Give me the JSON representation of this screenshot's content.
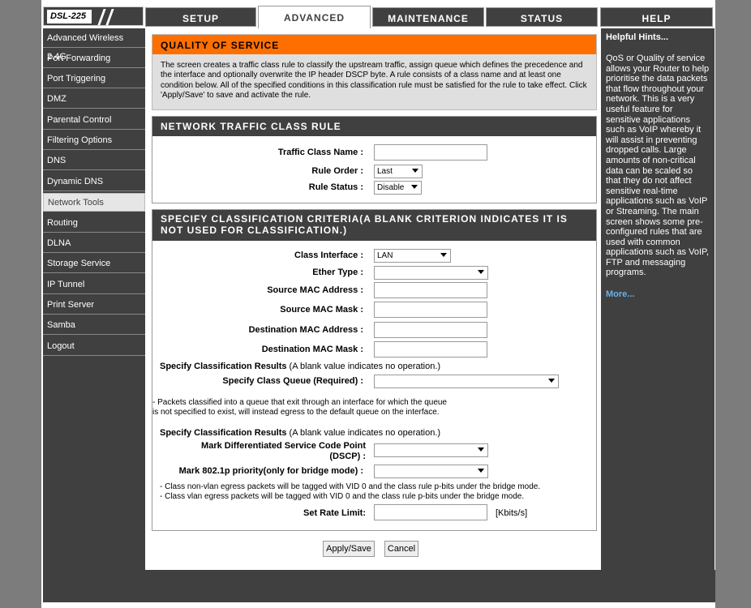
{
  "header": {
    "model": "DSL-225",
    "tabs": [
      {
        "label": "SETUP"
      },
      {
        "label": "ADVANCED"
      },
      {
        "label": "MAINTENANCE"
      },
      {
        "label": "STATUS"
      },
      {
        "label": "HELP"
      }
    ],
    "active_tab": "ADVANCED"
  },
  "sidebar": {
    "items": [
      {
        "label": "Advanced Wireless 2.4G"
      },
      {
        "label": "Port Forwarding"
      },
      {
        "label": "Port Triggering"
      },
      {
        "label": "DMZ"
      },
      {
        "label": "Parental Control"
      },
      {
        "label": "Filtering Options"
      },
      {
        "label": "DNS"
      },
      {
        "label": "Dynamic DNS"
      },
      {
        "label": "Network Tools"
      },
      {
        "label": "Routing"
      },
      {
        "label": "DLNA"
      },
      {
        "label": "Storage Service"
      },
      {
        "label": "IP Tunnel"
      },
      {
        "label": "Print Server"
      },
      {
        "label": "Samba"
      },
      {
        "label": "Logout"
      }
    ],
    "active_item": "Network Tools"
  },
  "qos": {
    "title": "QUALITY OF SERVICE",
    "description": "The screen creates a traffic class rule to classify the upstream traffic, assign queue which defines the precedence and the interface and optionally overwrite the IP header DSCP byte. A rule consists of a class name and at least one condition below. All of the specified conditions in this classification rule must be satisfied for the rule to take effect. Click 'Apply/Save' to save and activate the rule."
  },
  "rule": {
    "title": "NETWORK TRAFFIC CLASS RULE",
    "class_name_label": "Traffic Class Name :",
    "class_name_value": "",
    "rule_order_label": "Rule Order :",
    "rule_order_value": "Last",
    "rule_status_label": "Rule Status :",
    "rule_status_value": "Disable"
  },
  "criteria": {
    "title": "SPECIFY CLASSIFICATION CRITERIA(A BLANK CRITERION INDICATES IT IS NOT USED FOR CLASSIFICATION.)",
    "class_interface_label": "Class Interface :",
    "class_interface_value": "LAN",
    "ether_type_label": "Ether Type :",
    "ether_type_value": "",
    "src_mac_label": "Source MAC Address :",
    "src_mask_label": "Source MAC Mask :",
    "dst_mac_label": "Destination MAC Address :",
    "dst_mask_label": "Destination MAC Mask :",
    "results_heading": "Specify Classification Results",
    "results_note": " (A blank value indicates no operation.)",
    "class_queue_label": "Specify Class Queue (Required) :",
    "class_queue_value": "",
    "queue_note_1": "- Packets classified into a queue that exit through an interface for which the queue",
    "queue_note_2": "is not specified to exist, will instead egress to the default queue on the interface.",
    "results_heading_2": "Specify Classification Results",
    "results_note_2": " (A blank value indicates no operation.)",
    "dscp_label_1": "Mark Differentiated Service Code Point",
    "dscp_label_2": "(DSCP) :",
    "dscp_value": "",
    "p8021_label": "Mark 802.1p priority(only for bridge mode) :",
    "p8021_value": "",
    "vlan_note_1": "- Class non-vlan egress packets will be tagged with VID 0 and the class rule p-bits under the bridge mode.",
    "vlan_note_2": "- Class vlan egress packets will be tagged with VID 0 and the class rule p-bits under the bridge mode.",
    "rate_label": "Set Rate Limit:",
    "rate_unit": "[Kbits/s]"
  },
  "buttons": {
    "apply": "Apply/Save",
    "cancel": "Cancel"
  },
  "hints": {
    "title": "Helpful Hints...",
    "body": "QoS or Quality of service allows your Router to help prioritise the data packets that flow throughout your network. This is a very useful feature for sensitive applications such as VoIP whereby it will assist in preventing dropped calls. Large amounts of non-critical data can be scaled so that they do not affect sensitive real-time applications such as VoIP or Streaming. The main screen shows some pre-configured rules that are used with common applications such as VoIP, FTP and messaging programs.",
    "more": "More..."
  }
}
